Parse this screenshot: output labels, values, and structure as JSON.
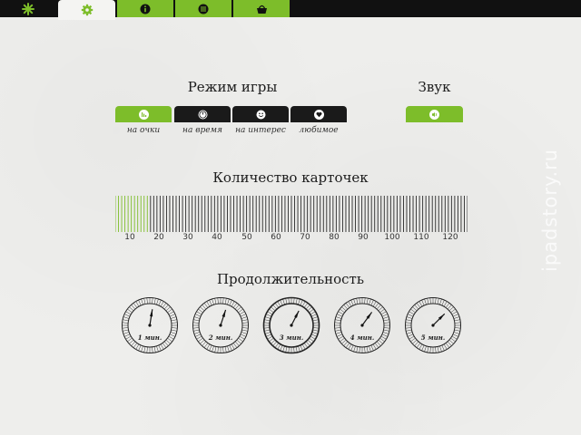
{
  "tabs": [
    {
      "icon": "asterisk-icon",
      "state": "green"
    },
    {
      "icon": "gear-icon",
      "state": "active"
    },
    {
      "icon": "info-icon",
      "state": "green"
    },
    {
      "icon": "list-icon",
      "state": "green"
    },
    {
      "icon": "basket-icon",
      "state": "green"
    }
  ],
  "game_mode": {
    "title": "Режим игры",
    "options": [
      {
        "label": "на очки",
        "icon": "bar-chart-icon",
        "selected": true
      },
      {
        "label": "на время",
        "icon": "clock-icon",
        "selected": false
      },
      {
        "label": "на интерес",
        "icon": "smiley-icon",
        "selected": false
      },
      {
        "label": "любимое",
        "icon": "heart-icon",
        "selected": false
      }
    ]
  },
  "sound": {
    "title": "Звук",
    "icon": "speaker-icon",
    "enabled": true
  },
  "cards": {
    "title": "Количество карточек",
    "ticks": [
      "10",
      "20",
      "30",
      "40",
      "50",
      "60",
      "70",
      "80",
      "90",
      "100",
      "110",
      "120"
    ],
    "min": 10,
    "max": 120,
    "value": 20
  },
  "duration": {
    "title": "Продолжительность",
    "options": [
      {
        "label": "1 мин.",
        "minutes": 1,
        "selected": false
      },
      {
        "label": "2 мин.",
        "minutes": 2,
        "selected": false
      },
      {
        "label": "3 мин.",
        "minutes": 3,
        "selected": true
      },
      {
        "label": "4 мин.",
        "minutes": 4,
        "selected": false
      },
      {
        "label": "5 мин.",
        "minutes": 5,
        "selected": false
      }
    ]
  },
  "watermark": "ipadstory.ru",
  "colors": {
    "accent": "#7dbd2a",
    "dark": "#1a1a1a"
  }
}
